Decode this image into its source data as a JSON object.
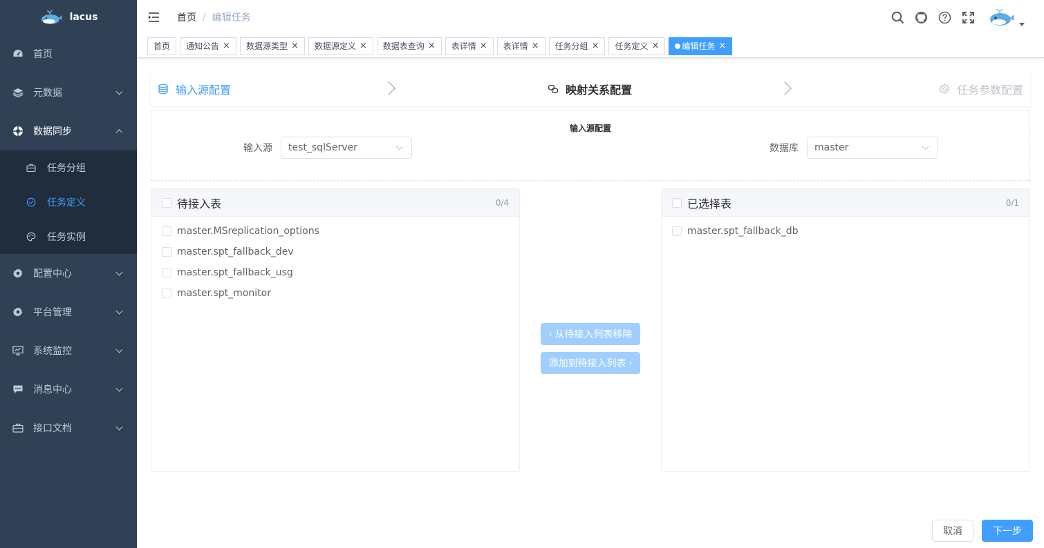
{
  "app": {
    "name": "lacus"
  },
  "sidebar": {
    "items": [
      {
        "label": "首页",
        "icon": "dashboard-icon"
      },
      {
        "label": "元数据",
        "icon": "layers-icon"
      },
      {
        "label": "数据同步",
        "icon": "sync-icon"
      },
      {
        "label": "配置中心",
        "icon": "gear-icon"
      },
      {
        "label": "平台管理",
        "icon": "gear-icon"
      },
      {
        "label": "系统监控",
        "icon": "monitor-icon"
      },
      {
        "label": "消息中心",
        "icon": "message-icon"
      },
      {
        "label": "接口文档",
        "icon": "briefcase-icon"
      }
    ],
    "sub_items": [
      {
        "label": "任务分组",
        "icon": "briefcase-icon"
      },
      {
        "label": "任务定义",
        "icon": "check-circle-icon"
      },
      {
        "label": "任务实例",
        "icon": "palette-icon"
      }
    ]
  },
  "breadcrumb": {
    "home": "首页",
    "current": "编辑任务",
    "separator": "/"
  },
  "tags": [
    "首页",
    "通知公告",
    "数据源类型",
    "数据源定义",
    "数据表查询",
    "表详情",
    "表详情",
    "任务分组",
    "任务定义",
    "编辑任务"
  ],
  "steps": [
    "输入源配置",
    "映射关系配置",
    "任务参数配置"
  ],
  "source_config": {
    "title": "输入源配置",
    "source_label": "输入源",
    "source_value": "test_sqlServer",
    "db_label": "数据库",
    "db_value": "master"
  },
  "transfer": {
    "left": {
      "title": "待接入表",
      "count": "0/4",
      "items": [
        "master.MSreplication_options",
        "master.spt_fallback_dev",
        "master.spt_fallback_usg",
        "master.spt_monitor"
      ]
    },
    "right": {
      "title": "已选择表",
      "count": "0/1",
      "items": [
        "master.spt_fallback_db"
      ]
    },
    "remove_label": "从待接入列表移除",
    "add_label": "添加到待接入列表"
  },
  "footer": {
    "cancel": "取消",
    "next": "下一步"
  },
  "colors": {
    "sidebar_bg": "#304156",
    "submenu_bg": "#1f2d3d",
    "primary": "#409eff",
    "disabled_primary": "#a0cfff"
  }
}
